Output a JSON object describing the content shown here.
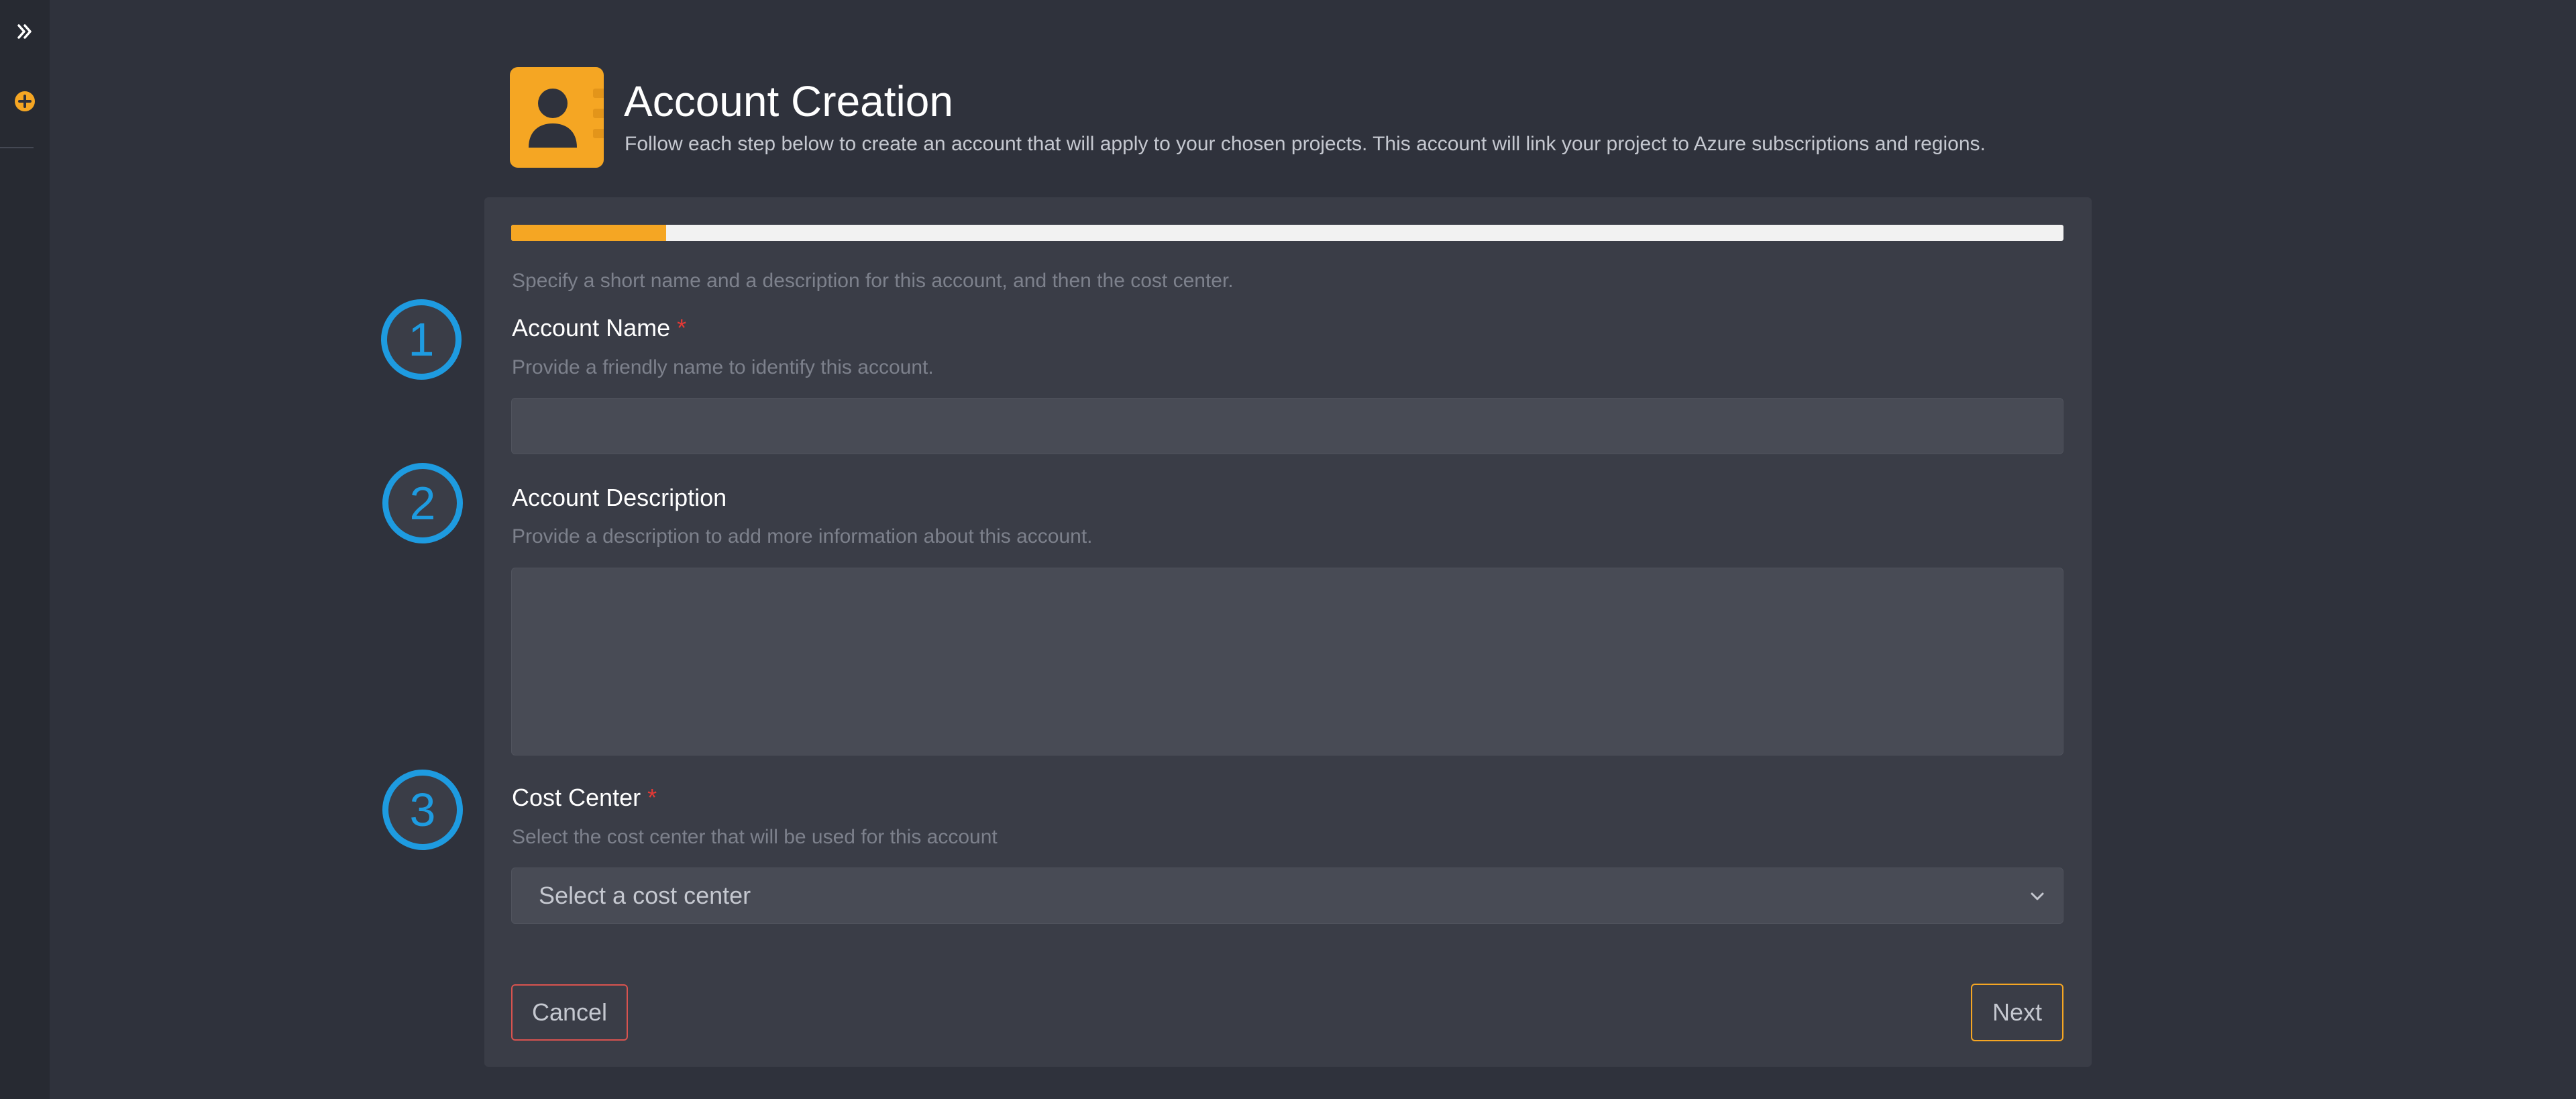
{
  "header": {
    "title": "Account Creation",
    "subtitle": "Follow each step below to create an account that will apply to your chosen projects. This account will link your project to Azure subscriptions and regions.",
    "icon": "contact-book-icon"
  },
  "colors": {
    "accent": "#f5a623",
    "step_circle": "#1e9be0",
    "required": "#e53935",
    "cancel_border": "#d9534f"
  },
  "sidebar": {
    "expand_icon": "double-chevron-right-icon",
    "add_icon": "plus-circle-icon"
  },
  "wizard": {
    "progress_percent": 10,
    "intro": "Specify a short name and a description for this account, and then the cost center.",
    "steps": [
      "1",
      "2",
      "3"
    ]
  },
  "form": {
    "account_name": {
      "label": "Account Name",
      "required_mark": "*",
      "help": "Provide a friendly name to identify this account.",
      "value": ""
    },
    "account_description": {
      "label": "Account Description",
      "help": "Provide a description to add more information about this account.",
      "value": ""
    },
    "cost_center": {
      "label": "Cost Center",
      "required_mark": "*",
      "help": "Select the cost center that will be used for this account",
      "placeholder": "Select a cost center"
    }
  },
  "buttons": {
    "cancel": "Cancel",
    "next": "Next"
  }
}
